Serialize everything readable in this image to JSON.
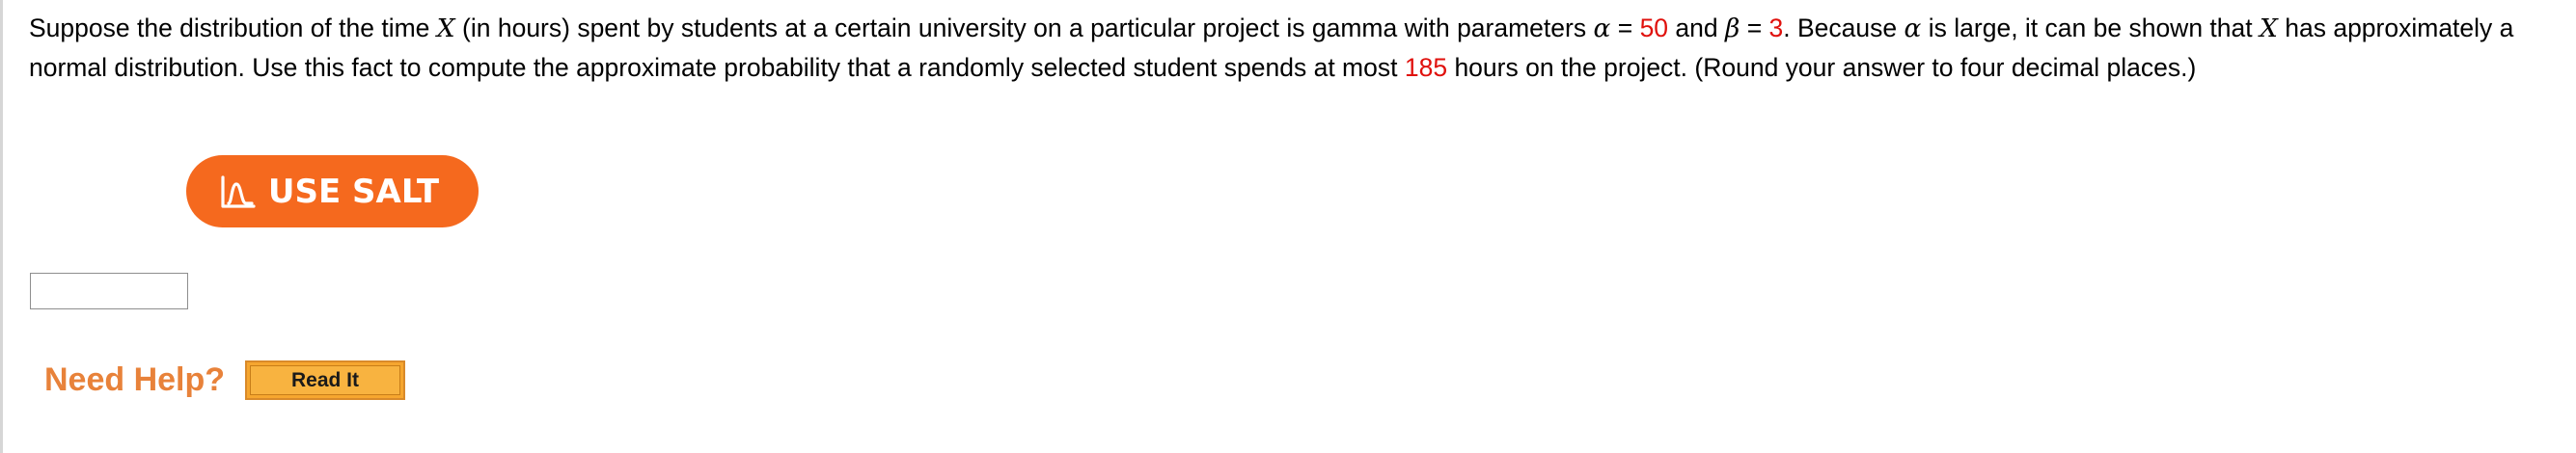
{
  "question": {
    "t1": "Suppose the distribution of the time ",
    "var_x": "X",
    "t2": " (in hours) spent by students at a certain university on a particular project is gamma with parameters ",
    "alpha_sym": "α",
    "eq1": " = ",
    "alpha_val": "50",
    "t3": " and ",
    "beta_sym": "β",
    "eq2": " = ",
    "beta_val": "3",
    "t4": ". Because ",
    "alpha_sym2": "α",
    "t5": " is large, it can be shown that ",
    "var_x2": "X",
    "t6": " has approximately a normal distribution. Use this fact to compute the approximate probability that a randomly selected student spends at most ",
    "hours_val": "185",
    "t7": " hours on the project. (Round your answer to four decimal places.)"
  },
  "salt_button": {
    "label": "USE SALT",
    "icon": "salt-distribution-icon"
  },
  "answer": {
    "value": "",
    "placeholder": ""
  },
  "help": {
    "label": "Need Help?",
    "read_it_label": "Read It"
  },
  "colors": {
    "given_value": "#e0110d",
    "salt_orange": "#f5691e",
    "help_orange": "#e8823a",
    "read_it_bg": "#f6a62f"
  }
}
